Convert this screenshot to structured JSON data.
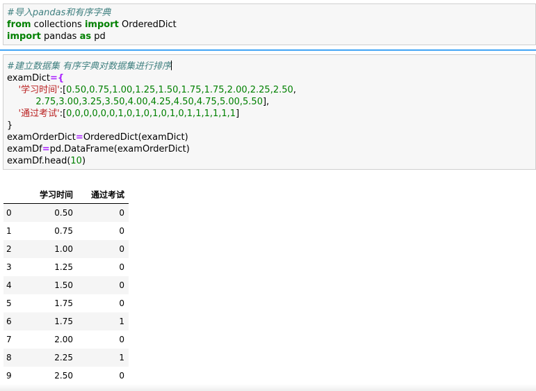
{
  "cell1": {
    "comment": "#导入pandas和有序字典",
    "line2": {
      "kw_from": "from",
      "module": " collections ",
      "kw_import": "import",
      "name": " OrderedDict"
    },
    "line3": {
      "kw_import": "import",
      "module": " pandas ",
      "kw_as": "as",
      "alias": " pd"
    }
  },
  "cell2": {
    "comment": "#建立数据集 有序字典对数据集进行排序",
    "l2": {
      "name": "examDict",
      "op": "=",
      "brace": "{"
    },
    "l3": {
      "indent": "    ",
      "key": "'学习时间'",
      "rest": ":[",
      "nums": "0.50,0.75,1.00,1.25,1.50,1.75,1.75,2.00,2.25,2.50",
      "end": ","
    },
    "l4": {
      "indent": "          ",
      "nums": "2.75,3.00,3.25,3.50,4.00,4.25,4.50,4.75,5.00,5.50",
      "end": "],"
    },
    "l5": {
      "indent": "    ",
      "key": "'通过考试'",
      "rest": ":[",
      "nums": "0,0,0,0,0,0,1,0,1,0,1,0,1,0,1,1,1,1,1,1",
      "end": "]"
    },
    "l6": "}",
    "l7": {
      "name": "examOrderDict",
      "op": "=",
      "rest": "OrderedDict(examDict)"
    },
    "l8": {
      "name": "examDf",
      "op": "=",
      "rest": "pd.DataFrame(examOrderDict)"
    },
    "l9": {
      "pre": "examDf.head(",
      "num": "10",
      "post": ")"
    }
  },
  "table": {
    "columns": [
      "",
      "学习时间",
      "通过考试"
    ],
    "rows": [
      [
        "0",
        "0.50",
        "0"
      ],
      [
        "1",
        "0.75",
        "0"
      ],
      [
        "2",
        "1.00",
        "0"
      ],
      [
        "3",
        "1.25",
        "0"
      ],
      [
        "4",
        "1.50",
        "0"
      ],
      [
        "5",
        "1.75",
        "0"
      ],
      [
        "6",
        "1.75",
        "1"
      ],
      [
        "7",
        "2.00",
        "0"
      ],
      [
        "8",
        "2.25",
        "1"
      ],
      [
        "9",
        "2.50",
        "0"
      ]
    ]
  },
  "colors": {
    "comment": "#408080",
    "keyword": "#008000",
    "string": "#ba2121",
    "operator": "#aa22ff",
    "selected_border": "#42a5f5"
  }
}
